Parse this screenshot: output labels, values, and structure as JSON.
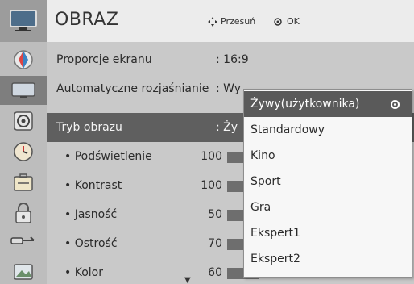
{
  "header": {
    "title": "OBRAZ",
    "move_hint": "Przesuń",
    "ok_hint": "OK"
  },
  "rail_icons": [
    "tv-icon",
    "picture-icon",
    "screen-icon",
    "audio-icon",
    "clock-icon",
    "options-icon",
    "lock-icon",
    "input-icon",
    "photo-icon"
  ],
  "menu": {
    "rows": [
      {
        "label": "Proporcje ekranu",
        "value": ": 16:9"
      },
      {
        "label": "Automatyczne rozjaśnianie",
        "value": ": Wy"
      },
      {
        "label": "Tryb obrazu",
        "value": ": Ży"
      }
    ],
    "sub_rows": [
      {
        "label": "• Podświetlenie",
        "value": "100",
        "level": 100
      },
      {
        "label": "• Kontrast",
        "value": "100",
        "level": 100
      },
      {
        "label": "• Jasność",
        "value": "50",
        "level": 50
      },
      {
        "label": "• Ostrość",
        "value": "70",
        "level": 70
      },
      {
        "label": "• Kolor",
        "value": "60",
        "level": 60
      }
    ]
  },
  "dropdown": {
    "options": [
      {
        "label": "Żywy(użytkownika)",
        "selected": true
      },
      {
        "label": "Standardowy",
        "selected": false
      },
      {
        "label": "Kino",
        "selected": false
      },
      {
        "label": "Sport",
        "selected": false
      },
      {
        "label": "Gra",
        "selected": false
      },
      {
        "label": "Ekspert1",
        "selected": false
      },
      {
        "label": "Ekspert2",
        "selected": false
      }
    ]
  },
  "colors": {
    "rail": "#bdbdbd",
    "panel": "#c9c9c9",
    "selected_row": "#5f5f5f",
    "dropdown_selected": "#5a5a5a"
  }
}
